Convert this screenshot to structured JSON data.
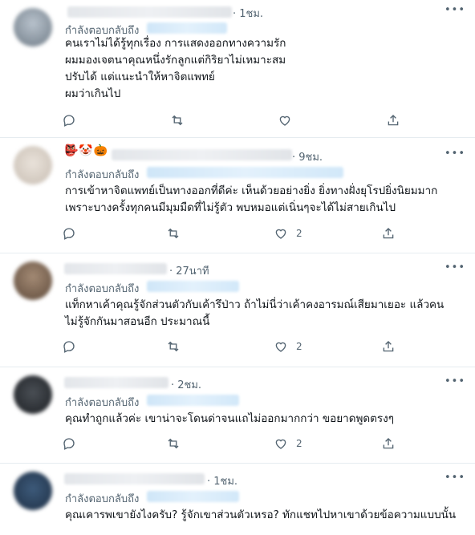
{
  "tweets": [
    {
      "time": "· 1ชม.",
      "reply_label": "กำลังตอบกลับถึง",
      "text": "คนเราไม่ได้รู้ทุกเรื่อง การแสดงออกทางความรัก\nผมมองเจตนาคุณหนึ่งรักลูกแต่กิริยาไม่เหมาะสม\nปรับได้ แต่แนะนำให้หาจิตแพทย์\nผมว่าเกินไป",
      "like_count": ""
    },
    {
      "time": "· 9ชม.",
      "reply_label": "กำลังตอบกลับถึง",
      "text": "การเข้าหาจิตแพทย์เป็นทางออกที่ดีค่ะ เห็นด้วยอย่างยิ่ง ยิ่งทางฝั่งยุโรปยิ่งนิยมมาก\nเพราะบางครั้งทุกคนมีมุมมืดที่ไม่รู้ตัว พบหมอแต่เนิ่นๆจะได้ไม่สายเกินไป",
      "like_count": "2",
      "emojis": "👺🤡🎃"
    },
    {
      "time": "· 27นาที",
      "reply_label": "กำลังตอบกลับถึง",
      "text": "แท็กหาเค้าคุณรู้จักส่วนตัวกับเค้ารึป่าว ถ้าไม่นี่ว่าเค้าคงอารมณ์เสียมาเยอะ แล้วคน\nไม่รู้จักกันมาสอนอีก ประมาณนี้",
      "like_count": "2"
    },
    {
      "time": "· 2ชม.",
      "reply_label": "กำลังตอบกลับถึง",
      "text": "คุณทำถูกแล้วค่ะ เขาน่าจะโดนด่าจนแถไม่ออกมากกว่า ขอยาดพูดตรงๆ",
      "like_count": "2"
    },
    {
      "time": "· 1ชม.",
      "reply_label": "กำลังตอบกลับถึง",
      "text": "คุณเคารพเขายังไงครับ? รู้จักเขาส่วนตัวเหรอ? ทักแชทไปหาเขาด้วยข้อความแบบนั้น",
      "like_count": ""
    }
  ],
  "icons": {
    "more": "more-icon",
    "reply": "reply-icon",
    "retweet": "retweet-icon",
    "like": "like-icon",
    "share": "share-icon"
  },
  "colors": {
    "icon_gray": "#536471",
    "link_blue": "#1d9bf0",
    "divider": "#e6ecf0"
  }
}
